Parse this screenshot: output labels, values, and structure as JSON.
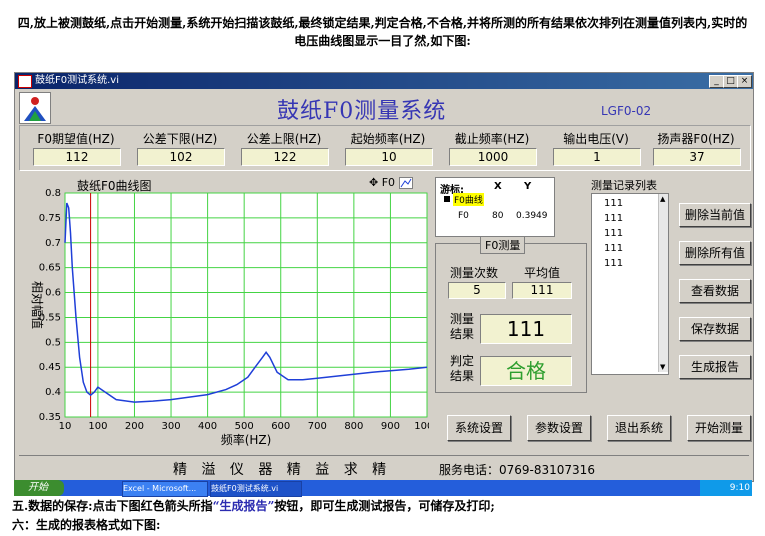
{
  "caption_top": {
    "line1": "四,放上被测鼓纸,点击开始测量,系统开始扫描该鼓纸,最终锁定结果,判定合格,不合格,并将所测的所有结果依次排列在测量值列表内,实时的",
    "line2": "电压曲线图显示一目了然,如下图:"
  },
  "window": {
    "title": "鼓纸F0测试系统.vi",
    "app_title": "鼓纸F0测量系统",
    "model": "LGF0-02",
    "buttons": {
      "minimize": "_",
      "maximize": "□",
      "close": "×"
    }
  },
  "params": [
    {
      "label": "F0期望值(HZ)",
      "value": "112"
    },
    {
      "label": "公差下限(HZ)",
      "value": "102"
    },
    {
      "label": "公差上限(HZ)",
      "value": "122"
    },
    {
      "label": "起始频率(HZ)",
      "value": "10"
    },
    {
      "label": "截止频率(HZ)",
      "value": "1000"
    },
    {
      "label": "输出电压(V)",
      "value": "1"
    },
    {
      "label": "扬声器F0(HZ)",
      "value": "37"
    }
  ],
  "chart_data": {
    "type": "line",
    "title": "鼓纸F0曲线图",
    "legend_label": "F0",
    "xlabel": "频率(HZ)",
    "ylabel": "相对幅值",
    "xlim": [
      10,
      1000
    ],
    "ylim": [
      0.35,
      0.8
    ],
    "xticks": [
      10,
      100,
      200,
      300,
      400,
      500,
      600,
      700,
      800,
      900,
      1000
    ],
    "yticks": [
      0.35,
      0.4,
      0.45,
      0.5,
      0.55,
      0.6,
      0.65,
      0.7,
      0.75,
      0.8
    ],
    "ytick_labels": [
      "0.35",
      "0.4",
      "0.45",
      "0.5",
      "0.55",
      "0.6",
      "0.65",
      "0.7",
      "0.75",
      "0.8"
    ],
    "grid": true,
    "cursor_x": 80,
    "series": [
      {
        "name": "F0曲线",
        "color": "#1f3fd8",
        "x": [
          10,
          15,
          20,
          25,
          30,
          40,
          50,
          60,
          70,
          80,
          90,
          100,
          120,
          150,
          200,
          250,
          300,
          350,
          400,
          450,
          480,
          510,
          530,
          550,
          560,
          570,
          590,
          620,
          660,
          700,
          750,
          800,
          850,
          900,
          950,
          1000
        ],
        "y": [
          0.7,
          0.78,
          0.77,
          0.72,
          0.65,
          0.55,
          0.47,
          0.42,
          0.4,
          0.394,
          0.4,
          0.41,
          0.4,
          0.385,
          0.38,
          0.382,
          0.385,
          0.39,
          0.395,
          0.405,
          0.415,
          0.43,
          0.45,
          0.47,
          0.48,
          0.47,
          0.44,
          0.425,
          0.425,
          0.428,
          0.432,
          0.436,
          0.44,
          0.443,
          0.446,
          0.45
        ]
      }
    ]
  },
  "cursor_panel": {
    "header_label": "游标:",
    "col_x": "X",
    "col_y": "Y",
    "curve_name": "F0曲线",
    "row_name": "F0",
    "row_x": "80",
    "row_y": "0.3949"
  },
  "f0_group": {
    "title": "F0测量",
    "count_label": "测量次数",
    "avg_label": "平均值",
    "count_value": "5",
    "avg_value": "111",
    "result_label_1": "测量",
    "result_label_2": "结果",
    "result_value": "111",
    "judge_label_1": "判定",
    "judge_label_2": "结果",
    "judge_value": "合格",
    "judge_color": "#2e9e2e"
  },
  "records": {
    "title": "测量记录列表",
    "items": [
      "111",
      "111",
      "111",
      "111",
      "111"
    ]
  },
  "side_buttons": {
    "delete_current": "删除当前值",
    "delete_all": "删除所有值",
    "view_data": "查看数据",
    "save_data": "保存数据",
    "generate_report": "生成报告"
  },
  "bottom_buttons": {
    "settings": "系统设置",
    "parameters": "参数设置",
    "exit": "退出系统",
    "start": "开始测量"
  },
  "footer": {
    "slogan": "精 溢 仪 器   精 益 求 精",
    "phone": "服务电话：0769-83107316"
  },
  "taskbar": {
    "start_label": "开始",
    "tasks": [
      "Excel - Microsoft...",
      "鼓纸F0测试系统.vi"
    ],
    "clock": "9:10"
  },
  "caption_bottom": {
    "line1_a": "五.数据的保存:点击下图红色箭头所指",
    "line1_hl": "“生成报告”",
    "line1_b": "按钮，即可生成测试报告，可储存及打印;",
    "line2": "六：生成的报表格式如下图:"
  },
  "colors": {
    "title_blue": "#3636b4",
    "curve": "#1f3fd8",
    "cursor_line": "#cc0000",
    "grid": "#44d444"
  }
}
